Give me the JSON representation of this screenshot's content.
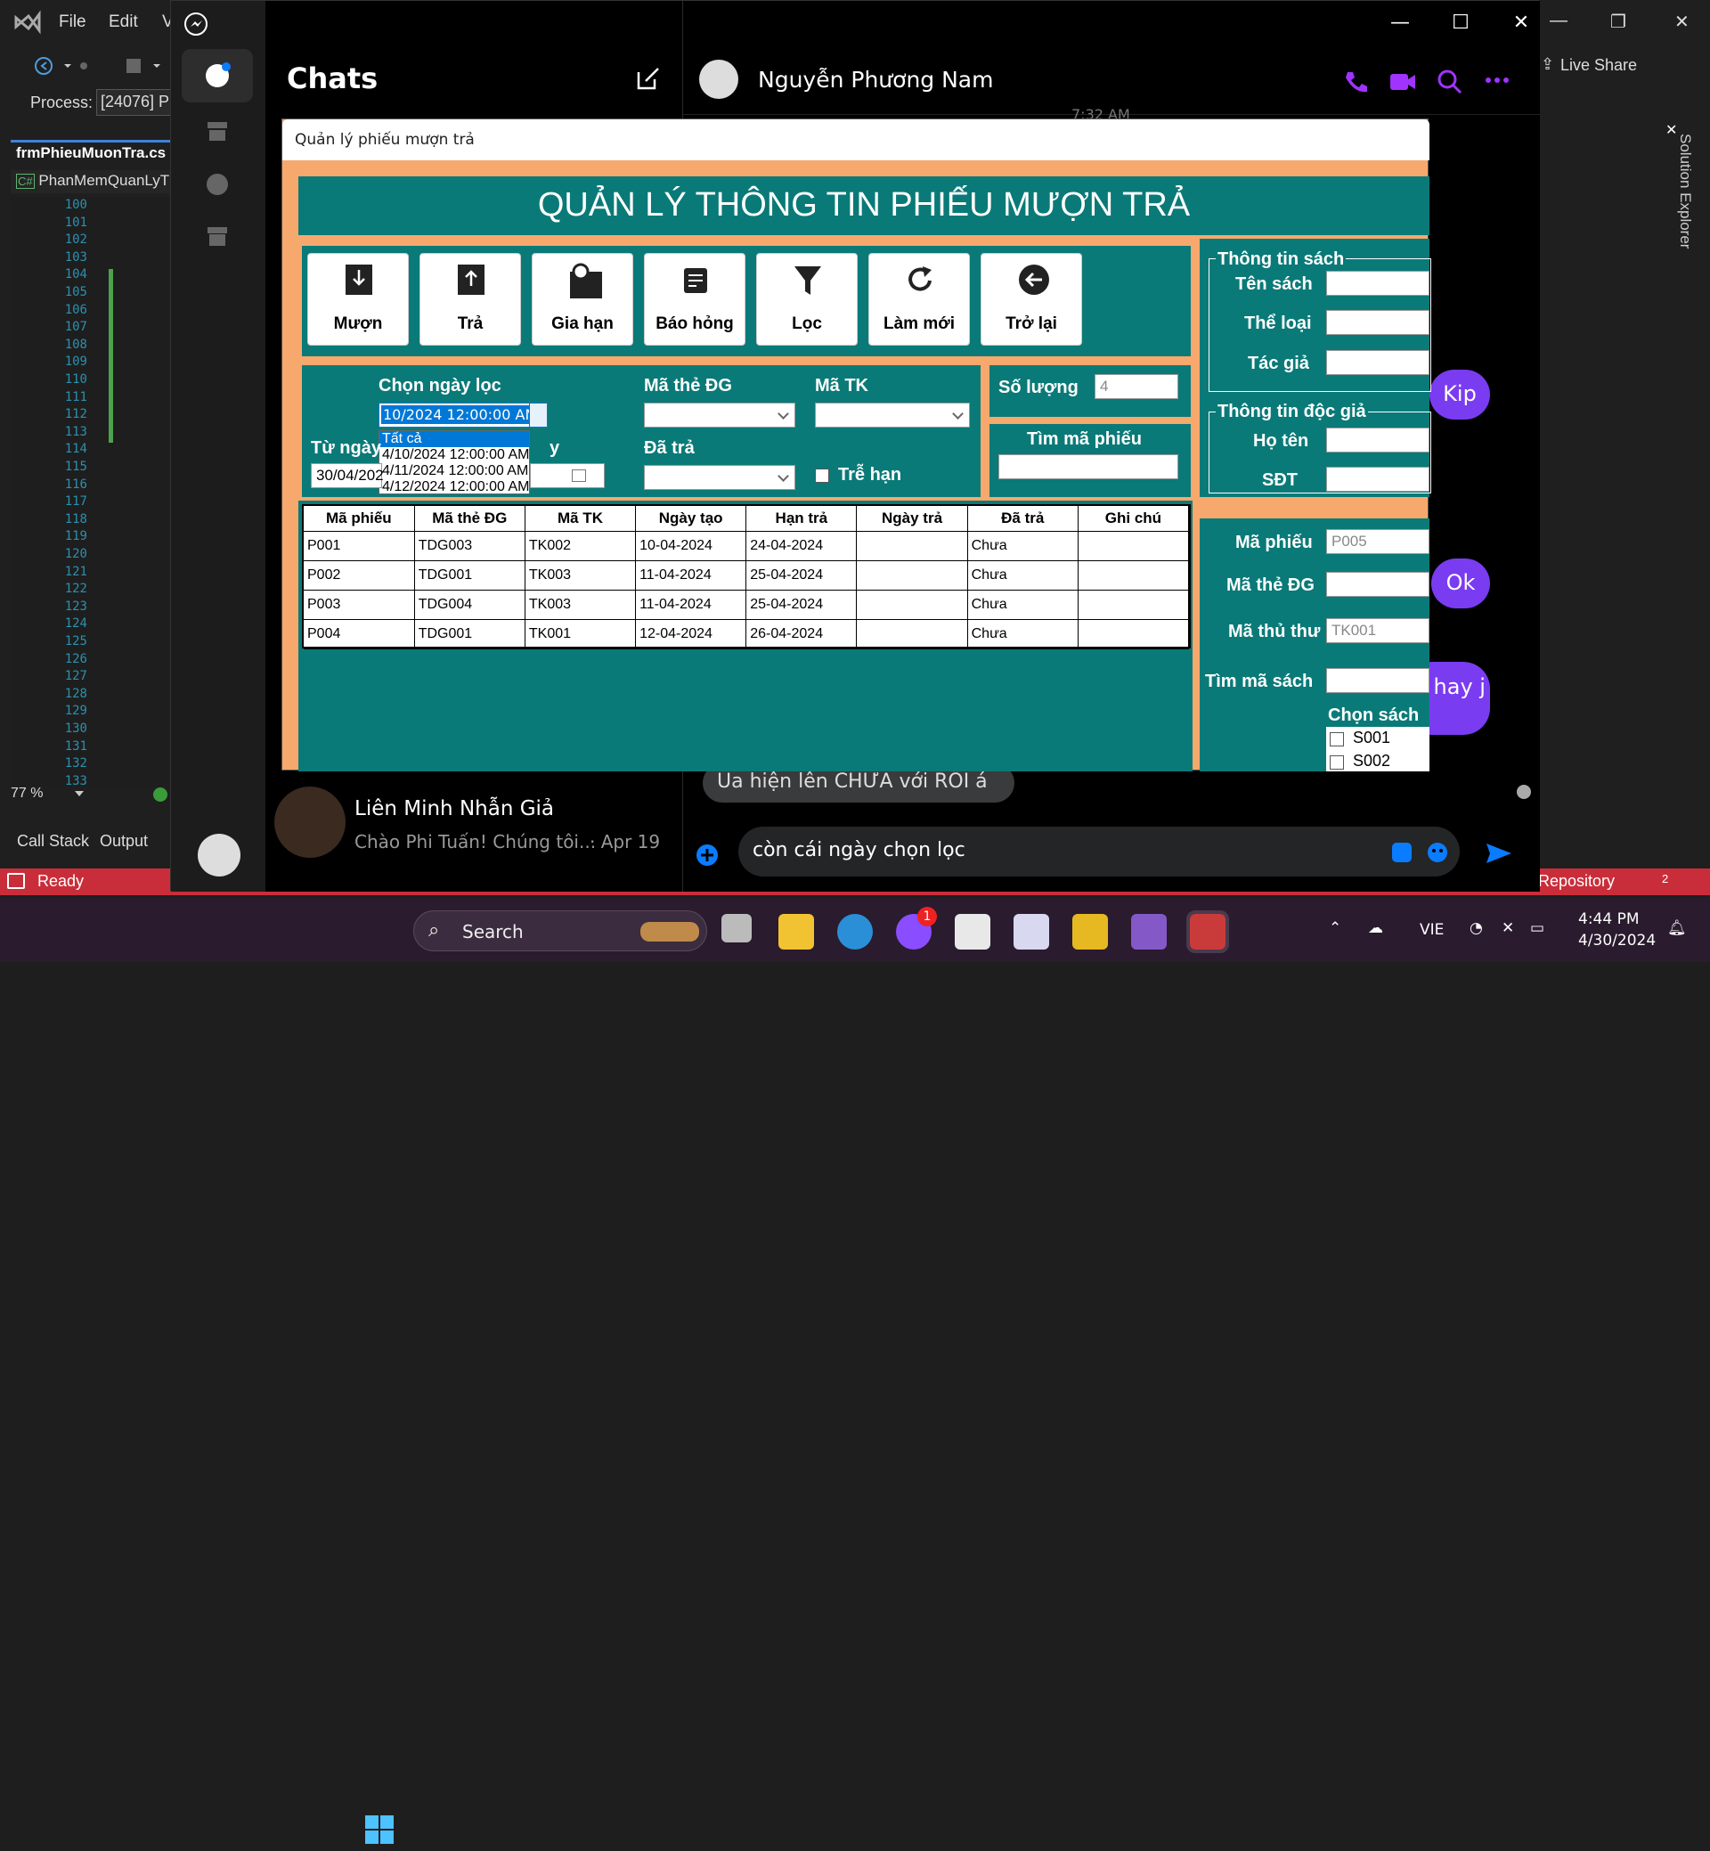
{
  "vs": {
    "menu": [
      "File",
      "Edit",
      "V"
    ],
    "process_label": "Process:",
    "process_value": "[24076] P",
    "tab": "frmPhieuMuonTra.cs",
    "tab2": "PhanMemQuanLyT",
    "lines": [
      "100",
      "101",
      "102",
      "103",
      "104",
      "105",
      "106",
      "107",
      "108",
      "109",
      "110",
      "111",
      "112",
      "113",
      "114",
      "115",
      "116",
      "117",
      "118",
      "119",
      "120",
      "121",
      "122",
      "123",
      "124",
      "125",
      "126",
      "127",
      "128",
      "129",
      "130",
      "131",
      "132",
      "133"
    ],
    "zoom": "77 %",
    "bottom_tabs": [
      "Call Stack",
      "Output"
    ],
    "status": "Ready",
    "live_share": "Live Share",
    "repository": "Repository",
    "solution_explorer": "Solution Explorer",
    "notif_count": "2"
  },
  "messenger": {
    "chats_title": "Chats",
    "contact": "Nguyễn Phương Nam",
    "time_header": "7:32 AM",
    "chat_item": {
      "name": "Liên Minh Nhẫn Giả",
      "preview": "Chào Phi Tuấn! Chúng tôi...",
      "date": "· Apr 19"
    },
    "bubbles": [
      "Kip",
      "Ok",
      "r hay j"
    ],
    "incoming": "Ủa hiện lên CHƯA với RỒI á",
    "input": "còn cái ngày chọn lọc",
    "colors": {
      "accent": "#7a3cf0",
      "icon": "#a033ff"
    }
  },
  "form": {
    "window_title": "Quản lý phiếu mượn trả",
    "title": "QUẢN LÝ THÔNG TIN PHIẾU MƯỢN TRẢ",
    "buttons": [
      "Mượn",
      "Trả",
      "Gia hạn",
      "Báo hỏng",
      "Lọc",
      "Làm mới",
      "Trở lại"
    ],
    "filter": {
      "chon_ngay": "Chọn ngày lọc",
      "date_value": "10/2024 12:00:00 AM",
      "options": [
        "Tất cả",
        "4/10/2024 12:00:00 AM",
        "4/11/2024 12:00:00 AM",
        "4/12/2024 12:00:00 AM"
      ],
      "tu_ngay": "Từ ngày",
      "tu_ngay_value": "30/04/202",
      "y_label": "y",
      "ma_the": "Mã thẻ ĐG",
      "ma_tk": "Mã TK",
      "da_tra": "Đã trả",
      "tre_han": "Trễ hạn",
      "so_luong": "Số lượng",
      "so_luong_value": "4",
      "tim_ma_phieu": "Tìm mã phiếu"
    },
    "sach": {
      "group": "Thông tin sách",
      "ten": "Tên sách",
      "the_loai": "Thể loại",
      "tac_gia": "Tác giả"
    },
    "doc_gia": {
      "group": "Thông tin độc giả",
      "ho_ten": "Họ tên",
      "sdt": "SĐT"
    },
    "phieu": {
      "ma_phieu": "Mã phiếu",
      "ma_phieu_value": "P005",
      "ma_the": "Mã thẻ ĐG",
      "ma_thu_thu": "Mã thủ thư",
      "ma_thu_thu_value": "TK001",
      "tim_sach": "Tìm mã sách",
      "chon_sach": "Chọn sách",
      "books": [
        "S001",
        "S002"
      ]
    },
    "table": {
      "headers": [
        "Mã phiếu",
        "Mã thẻ ĐG",
        "Mã TK",
        "Ngày tạo",
        "Hạn trả",
        "Ngày trả",
        "Đã trả",
        "Ghi chú"
      ],
      "rows": [
        [
          "P001",
          "TDG003",
          "TK002",
          "10-04-2024",
          "24-04-2024",
          "",
          "Chưa",
          ""
        ],
        [
          "P002",
          "TDG001",
          "TK003",
          "11-04-2024",
          "25-04-2024",
          "",
          "Chưa",
          ""
        ],
        [
          "P003",
          "TDG004",
          "TK003",
          "11-04-2024",
          "25-04-2024",
          "",
          "Chưa",
          ""
        ],
        [
          "P004",
          "TDG001",
          "TK001",
          "12-04-2024",
          "26-04-2024",
          "",
          "Chưa",
          ""
        ]
      ]
    }
  },
  "taskbar": {
    "search": "Search",
    "lang": "VIE",
    "time": "4:44 PM",
    "date": "4/30/2024",
    "badge": "1"
  }
}
